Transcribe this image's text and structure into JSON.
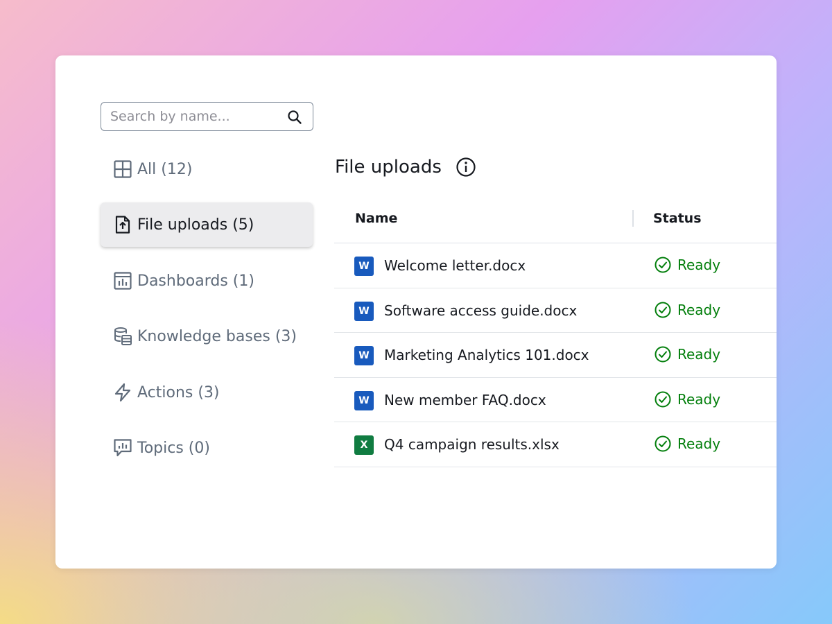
{
  "search": {
    "placeholder": "Search by name..."
  },
  "sidebar": {
    "items": [
      {
        "label": "All (12)",
        "icon": "grid-icon",
        "active": false
      },
      {
        "label": "File uploads (5)",
        "icon": "file-upload-icon",
        "active": true
      },
      {
        "label": "Dashboards (1)",
        "icon": "dashboard-icon",
        "active": false
      },
      {
        "label": "Knowledge bases (3)",
        "icon": "database-icon",
        "active": false
      },
      {
        "label": "Actions (3)",
        "icon": "lightning-icon",
        "active": false
      },
      {
        "label": "Topics (0)",
        "icon": "chat-chart-icon",
        "active": false
      }
    ]
  },
  "main": {
    "title": "File uploads",
    "info_icon": "info-icon",
    "table": {
      "columns": [
        "Name",
        "Status"
      ],
      "rows": [
        {
          "file_type": "W",
          "name": "Welcome letter.docx",
          "status": "Ready"
        },
        {
          "file_type": "W",
          "name": "Software access guide.docx",
          "status": "Ready"
        },
        {
          "file_type": "W",
          "name": "Marketing Analytics 101.docx",
          "status": "Ready"
        },
        {
          "file_type": "W",
          "name": "New member FAQ.docx",
          "status": "Ready"
        },
        {
          "file_type": "X",
          "name": "Q4 campaign results.xlsx",
          "status": "Ready"
        }
      ]
    }
  },
  "colors": {
    "word_blue": "#185abd",
    "excel_green": "#107c41",
    "status_green": "#037f0c",
    "icon_gray": "#5f6b7a",
    "active_bg": "#ececee"
  }
}
